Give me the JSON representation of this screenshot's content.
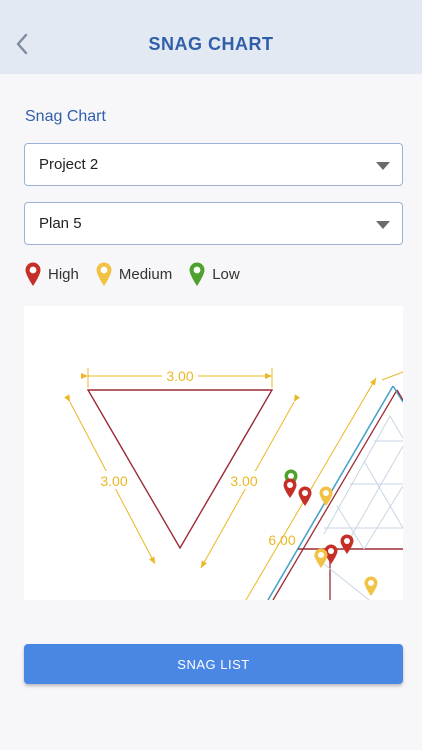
{
  "header": {
    "title": "SNAG CHART",
    "back_icon": "chevron-left-icon"
  },
  "section_title": "Snag Chart",
  "project_select": {
    "value": "Project 2"
  },
  "plan_select": {
    "value": "Plan 5"
  },
  "legend": [
    {
      "label": "High",
      "color": "#c62f27",
      "icon": "map-pin-icon"
    },
    {
      "label": "Medium",
      "color": "#f1c244",
      "icon": "map-pin-icon"
    },
    {
      "label": "Low",
      "color": "#4fa12e",
      "icon": "map-pin-icon"
    }
  ],
  "plan": {
    "dimension_labels": [
      "3.00",
      "3.00",
      "3.00",
      "6.00"
    ],
    "line_color": "#9c2b34",
    "dimension_color": "#e8b825"
  },
  "snag_list_button": "SNAG LIST"
}
